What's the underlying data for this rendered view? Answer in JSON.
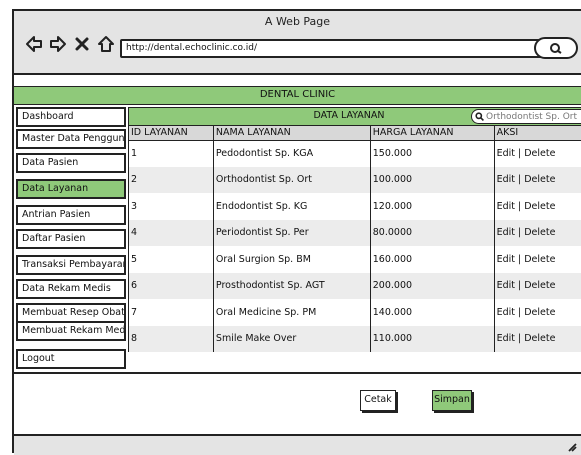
{
  "window": {
    "title": "A Web Page",
    "url": "http://dental.echoclinic.co.id/"
  },
  "header": {
    "clinic_name": "DENTAL CLINIC"
  },
  "sidebar": {
    "items": [
      {
        "label": "Dashboard",
        "active": false
      },
      {
        "label": "Master Data Pengguna",
        "active": false
      },
      {
        "label": "Data Pasien",
        "active": false
      },
      {
        "label": "Data Layanan",
        "active": true
      },
      {
        "label": "Antrian Pasien",
        "active": false
      },
      {
        "label": "Daftar Pasien",
        "active": false
      },
      {
        "label": "Transaksi Pembayaran",
        "active": false
      },
      {
        "label": "Data Rekam Medis",
        "active": false
      },
      {
        "label": "Membuat Resep Obat",
        "active": false
      },
      {
        "label": "Membuat Rekam Medis",
        "active": false
      },
      {
        "label": "Logout",
        "active": false
      }
    ]
  },
  "main": {
    "title": "DATA LAYANAN",
    "search_value": "Orthodontist Sp. Ort",
    "columns": [
      "ID LAYANAN",
      "NAMA LAYANAN",
      "HARGA LAYANAN",
      "AKSI"
    ],
    "rows": [
      {
        "id": "1",
        "name": "Pedodontist Sp. KGA",
        "price": "150.000",
        "action": "Edit | Delete"
      },
      {
        "id": "2",
        "name": "Orthodontist Sp. Ort",
        "price": "100.000",
        "action": "Edit | Delete"
      },
      {
        "id": "3",
        "name": "Endodontist  Sp. KG",
        "price": "120.000",
        "action": "Edit | Delete"
      },
      {
        "id": "4",
        "name": "Periodontist Sp. Per",
        "price": "80.0000",
        "action": "Edit | Delete"
      },
      {
        "id": "5",
        "name": "Oral Surgion Sp. BM",
        "price": "160.000",
        "action": "Edit | Delete"
      },
      {
        "id": "6",
        "name": "Prosthodontist Sp. AGT",
        "price": "200.000",
        "action": "Edit | Delete"
      },
      {
        "id": "7",
        "name": "Oral Medicine Sp. PM",
        "price": "140.000",
        "action": "Edit | Delete"
      },
      {
        "id": "8",
        "name": "Smile Make Over",
        "price": "110.000",
        "action": "Edit | Delete"
      }
    ]
  },
  "buttons": {
    "print_label": "Cetak",
    "save_label": "Simpan"
  },
  "colors": {
    "accent": "#8fc97a",
    "chrome": "#e4e4e4"
  }
}
